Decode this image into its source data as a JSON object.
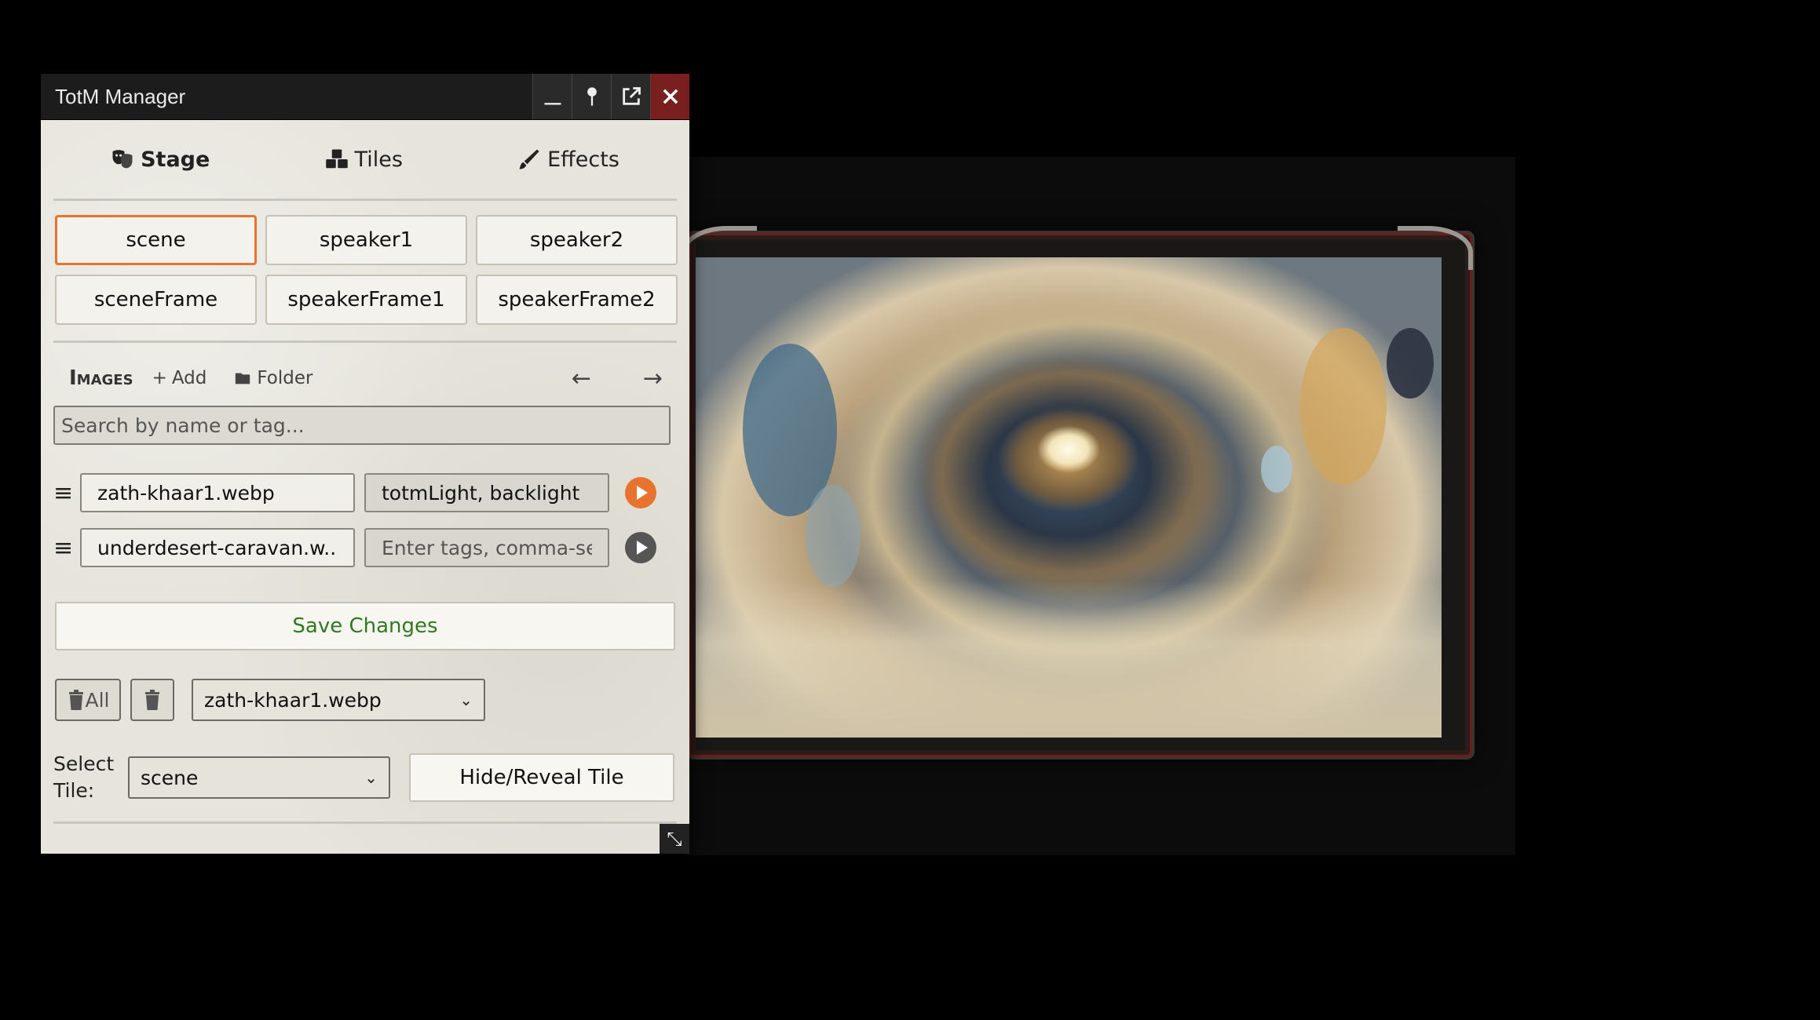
{
  "window": {
    "title": "TotM Manager",
    "controls": {
      "minimize": "minimize-icon",
      "pin": "pin-icon",
      "popout": "popout-icon",
      "close": "close-icon"
    }
  },
  "tabs": [
    {
      "label": "Stage",
      "icon": "theater-masks-icon",
      "active": true
    },
    {
      "label": "Tiles",
      "icon": "cubes-icon",
      "active": false
    },
    {
      "label": "Effects",
      "icon": "paintbrush-icon",
      "active": false
    }
  ],
  "tile_buttons": [
    "scene",
    "speaker1",
    "speaker2",
    "sceneFrame",
    "speakerFrame1",
    "speakerFrame2"
  ],
  "selected_tile_button": "scene",
  "images": {
    "title": "Images",
    "add_label": "Add",
    "folder_label": "Folder",
    "search_placeholder": "Search by name or tag...",
    "rows": [
      {
        "name": "zath-khaar1.webp",
        "tags": "totmLight, backlight",
        "tags_placeholder": "",
        "active": true
      },
      {
        "name": "underdesert-caravan.w...",
        "tags": "",
        "tags_placeholder": "Enter tags, comma-sep",
        "active": false
      }
    ]
  },
  "save_label": "Save Changes",
  "delete_all_label": "All",
  "image_select_value": "zath-khaar1.webp",
  "select_tile_label": "Select Tile:",
  "select_tile_value": "scene",
  "hide_reveal_label": "Hide/Reveal Tile",
  "colors": {
    "accent": "#e8732e",
    "save_text": "#2f7a1f",
    "close_bg": "#7a1f1f"
  }
}
